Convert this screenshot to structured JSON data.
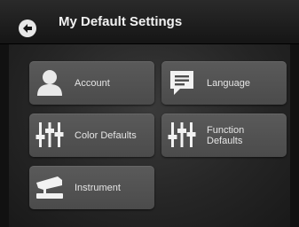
{
  "header": {
    "title": "My Default Settings",
    "back_icon": "back-arrow-icon"
  },
  "menu": {
    "account": {
      "label": "Account",
      "icon": "user-icon"
    },
    "language": {
      "label": "Language",
      "icon": "speech-bubble-icon"
    },
    "color_defaults": {
      "label": "Color Defaults",
      "icon": "sliders-icon"
    },
    "function_defaults": {
      "label_line1": "Function",
      "label_line2": "Defaults",
      "icon": "sliders-icon"
    },
    "instrument": {
      "label": "Instrument",
      "icon": "instrument-icon"
    }
  }
}
